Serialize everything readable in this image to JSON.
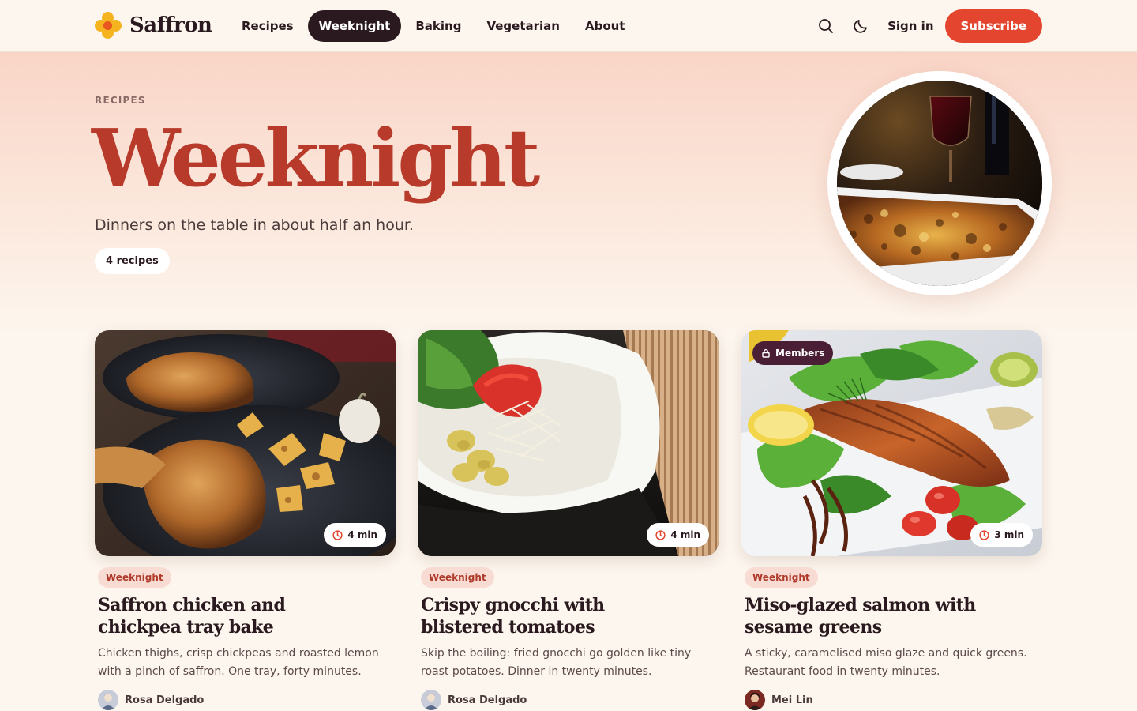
{
  "brand": {
    "name": "Saffron",
    "accent": "#e3452f",
    "title_color": "#b83a2a"
  },
  "nav": {
    "links": [
      {
        "label": "Recipes",
        "active": false
      },
      {
        "label": "Weeknight",
        "active": true
      },
      {
        "label": "Baking",
        "active": false
      },
      {
        "label": "Vegetarian",
        "active": false
      },
      {
        "label": "About",
        "active": false
      }
    ],
    "icons": [
      "search-icon",
      "moon-icon"
    ],
    "signin_label": "Sign in",
    "subscribe_label": "Subscribe"
  },
  "hero": {
    "eyebrow": "RECIPES",
    "title": "Weeknight",
    "subtitle": "Dinners on the table in about half an hour.",
    "count": "4 recipes"
  },
  "cards": [
    {
      "time": "4 min",
      "tag": "Weeknight",
      "title": "Saffron chicken and chickpea tray bake",
      "description": "Chicken thighs, crisp chickpeas and roasted lemon with a pinch of saffron. One tray, forty minutes.",
      "author": "Rosa Delgado",
      "members": null
    },
    {
      "time": "4 min",
      "tag": "Weeknight",
      "title": "Crispy gnocchi with blistered tomatoes",
      "description": "Skip the boiling: fried gnocchi go golden like tiny roast potatoes. Dinner in twenty minutes.",
      "author": "Rosa Delgado",
      "members": null
    },
    {
      "time": "3 min",
      "tag": "Weeknight",
      "title": "Miso-glazed salmon with sesame greens",
      "description": "A sticky, caramelised miso glaze and quick greens. Restaurant food in twenty minutes.",
      "author": "Mei Lin",
      "members": "Members"
    }
  ]
}
